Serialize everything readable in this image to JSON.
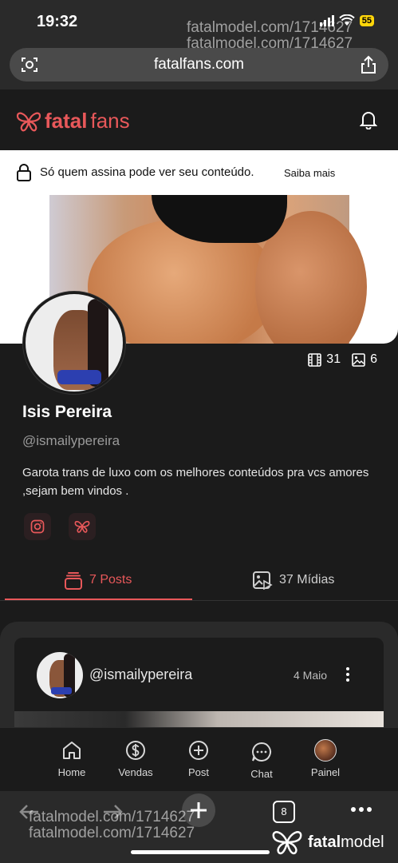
{
  "status_bar": {
    "time": "19:32",
    "battery": "55"
  },
  "browser": {
    "url": "fatalfans.com"
  },
  "header": {
    "logo_bold": "fatal",
    "logo_light": "fans"
  },
  "notice": {
    "message": "Só quem assina pode ver seu conteúdo.",
    "link": "Saiba mais"
  },
  "profile": {
    "videos_count": "31",
    "photos_count": "6",
    "name": "Isis Pereira",
    "handle": "@ismailypereira",
    "bio": "Garota trans de luxo com os melhores conteúdos pra vcs amores ,sejam bem vindos ."
  },
  "tabs": [
    {
      "label": "7 Posts",
      "active": true
    },
    {
      "label": "37 Mídias",
      "active": false
    }
  ],
  "post": {
    "handle": "@ismailypereira",
    "date": "4 Maio"
  },
  "bottom_nav": [
    {
      "label": "Home",
      "icon": "home-icon"
    },
    {
      "label": "Vendas",
      "icon": "dollar-icon"
    },
    {
      "label": "Post",
      "icon": "plus-icon"
    },
    {
      "label": "Chat",
      "icon": "chat-icon"
    },
    {
      "label": "Painel",
      "icon": "avatar"
    }
  ],
  "safari": {
    "tab_count": "8"
  },
  "watermark": {
    "text": "fatalmodel.com/1714627",
    "brand_bold": "fatal",
    "brand_light": "model"
  },
  "colors": {
    "accent": "#e8585a",
    "background": "#1b1b1b"
  }
}
